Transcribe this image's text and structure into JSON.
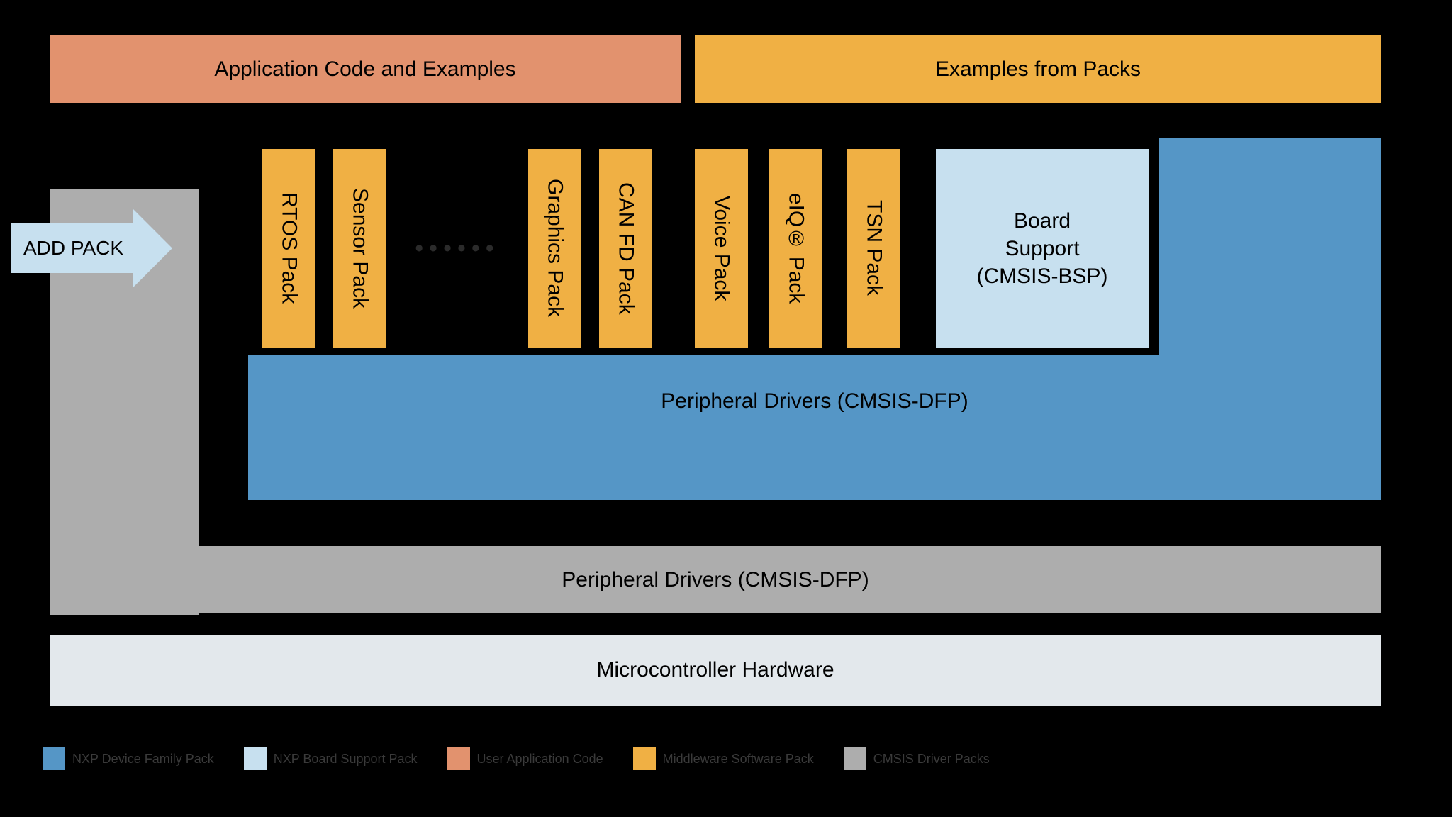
{
  "colors": {
    "orange": "#f0b044",
    "salmon": "#e2926e",
    "blue": "#5596c6",
    "lightblue": "#c7e0ef",
    "grey": "#adadad",
    "palegrey": "#e3e8ec"
  },
  "top": {
    "app_code": "Application Code and Examples",
    "examples_packs": "Examples from Packs"
  },
  "add_pack": "ADD PACK",
  "packs": {
    "rtos": "RTOS Pack",
    "sensor": "Sensor Pack",
    "graphics": "Graphics Pack",
    "canfd": "CAN FD Pack",
    "voice": "Voice Pack",
    "eiq": "eIQ® Pack",
    "tsn": "TSN Pack"
  },
  "bsp": {
    "line1": "Board",
    "line2": "Support",
    "line3": "(CMSIS-BSP)"
  },
  "drivers_blue": "Peripheral Drivers (CMSIS-DFP)",
  "drivers_grey": "Peripheral Drivers (CMSIS-DFP)",
  "hardware": "Microcontroller Hardware",
  "legend": {
    "dfp": "NXP Device Family Pack",
    "bsp": "NXP Board Support Pack",
    "user": "User Application Code",
    "mw": "Middleware Software Pack",
    "cmsis": "CMSIS Driver Packs"
  }
}
